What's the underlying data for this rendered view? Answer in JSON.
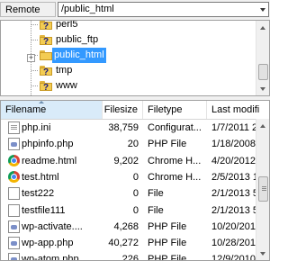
{
  "remote_site": {
    "label": "Remote site:",
    "path": "/public_html"
  },
  "tree": {
    "items": [
      {
        "label": "perl5",
        "selected": false
      },
      {
        "label": "public_ftp",
        "selected": false
      },
      {
        "label": "public_html",
        "selected": true
      },
      {
        "label": "tmp",
        "selected": false
      },
      {
        "label": "www",
        "selected": false
      }
    ],
    "expander_symbol": "+"
  },
  "file_list": {
    "columns": [
      "Filename",
      "Filesize",
      "Filetype",
      "Last modifi"
    ],
    "sorted_column": "Filename",
    "rows": [
      {
        "icon": "document-icon",
        "name": "php.ini",
        "size": "38,759",
        "type": "Configurat...",
        "modified": "1/7/2011 2..."
      },
      {
        "icon": "php-file-icon",
        "name": "phpinfo.php",
        "size": "20",
        "type": "PHP File",
        "modified": "1/18/2008 5..."
      },
      {
        "icon": "chrome-icon",
        "name": "readme.html",
        "size": "9,202",
        "type": "Chrome H...",
        "modified": "4/20/2012 8..."
      },
      {
        "icon": "chrome-icon",
        "name": "test.html",
        "size": "0",
        "type": "Chrome H...",
        "modified": "2/5/2013 10..."
      },
      {
        "icon": "file-icon",
        "name": "test222",
        "size": "0",
        "type": "File",
        "modified": "2/1/2013 5:..."
      },
      {
        "icon": "file-icon",
        "name": "testfile111",
        "size": "0",
        "type": "File",
        "modified": "2/1/2013 5:..."
      },
      {
        "icon": "php-file-icon",
        "name": "wp-activate....",
        "size": "4,268",
        "type": "PHP File",
        "modified": "10/20/2011 ..."
      },
      {
        "icon": "php-file-icon",
        "name": "wp-app.php",
        "size": "40,272",
        "type": "PHP File",
        "modified": "10/28/2011 ..."
      },
      {
        "icon": "php-file-icon",
        "name": "wp-atom.php",
        "size": "226",
        "type": "PHP File",
        "modified": "12/9/2010 1..."
      }
    ]
  }
}
